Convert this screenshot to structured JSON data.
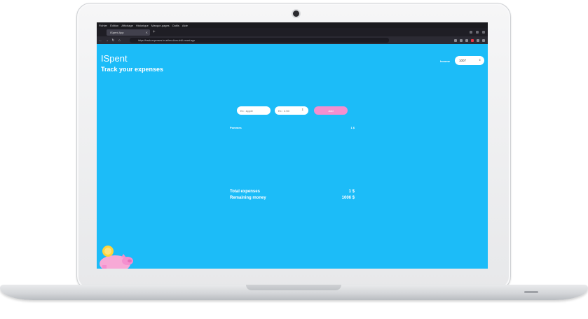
{
  "os_menu": [
    "Fichier",
    "Édition",
    "Affichage",
    "Historique",
    "Marque-pages",
    "Outils",
    "Aide"
  ],
  "browser": {
    "tab_title": "ISpent App",
    "url": "https://track-expenses-in-ablen-dium-chill-crowd.app"
  },
  "app": {
    "brand": "ISpent",
    "tagline": "Track your expenses",
    "budget_label": "Income",
    "budget_value": "1007",
    "expense_name_placeholder": "Ex : Apple",
    "expense_amount_placeholder": "Ex : 2.50",
    "add_button": "Add",
    "expenses": [
      {
        "name": "Pommes",
        "amount": "1 $"
      }
    ],
    "total_label": "Total expenses",
    "total_value": "1 $",
    "remaining_label": "Remaining money",
    "remaining_value": "1006 $"
  },
  "colors": {
    "app_background": "#1cbcf8",
    "accent_button": "#f48fcf"
  }
}
